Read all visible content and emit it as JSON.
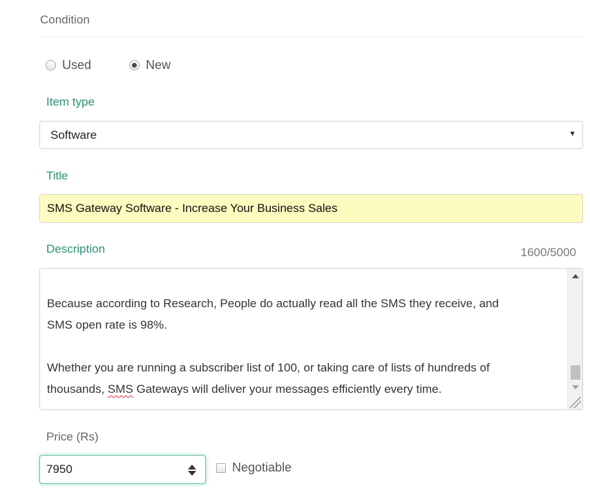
{
  "condition": {
    "title": "Condition",
    "options": [
      {
        "label": "Used",
        "checked": false
      },
      {
        "label": "New",
        "checked": true
      }
    ]
  },
  "item_type": {
    "label": "Item type",
    "selected": "Software"
  },
  "title_field": {
    "label": "Title",
    "value": "SMS Gateway Software - Increase Your Business Sales",
    "background": "#fcfcc0"
  },
  "description": {
    "label": "Description",
    "char_count": "1600/5000",
    "paragraph_1_line_1": "Because according to Research, People do actually read all the SMS they receive, and",
    "paragraph_1_line_2": "SMS open rate is 98%.",
    "paragraph_2_line_1": "Whether you are running a subscriber list of 100, or taking care of lists of hundreds of",
    "paragraph_2_line_2_prefix": "thousands, ",
    "paragraph_2_line_2_misspelled": "SMS",
    "paragraph_2_line_2_suffix": " Gateways will deliver your messages efficiently every time."
  },
  "price": {
    "label": "Price (Rs)",
    "value": "7950",
    "negotiable_label": "Negotiable",
    "negotiable_checked": false
  },
  "colors": {
    "accent": "#2a9077",
    "focus": "#66c2a5"
  }
}
